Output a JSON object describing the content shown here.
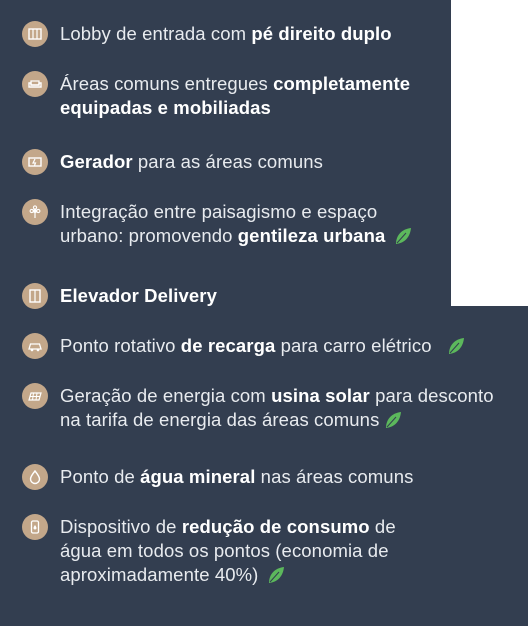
{
  "colors": {
    "panel": "#333e50",
    "icon_circle": "#c3a78a",
    "text": "#e8ebef",
    "leaf": "#5cb85c"
  },
  "items": [
    {
      "icon": "lobby-icon",
      "before": "Lobby de entrada com ",
      "bold": "pé direito duplo",
      "after": "",
      "eco": false
    },
    {
      "icon": "sofa-icon",
      "before": "Áreas comuns entregues ",
      "bold": "completamente equipadas e mobiliadas",
      "after": "",
      "eco": false
    },
    {
      "icon": "generator-icon",
      "before": "",
      "bold": "Gerador",
      "after": " para as áreas comuns",
      "eco": false
    },
    {
      "icon": "flower-icon",
      "before": "Integração entre paisagismo e espaço urbano: promovendo ",
      "bold": "gentileza urbana",
      "after": "",
      "eco": true
    },
    {
      "icon": "elevator-icon",
      "before": "",
      "bold": "Elevador Delivery",
      "after": "",
      "eco": false
    },
    {
      "icon": "car-charger-icon",
      "before": "Ponto rotativo ",
      "bold": "de recarga",
      "after": " para carro elétrico",
      "eco": true
    },
    {
      "icon": "solar-panel-icon",
      "before": "Geração de energia com ",
      "bold": "usina solar",
      "after": " para desconto na tarifa de energia das áreas comuns",
      "eco": true
    },
    {
      "icon": "water-drop-icon",
      "before": "Ponto de ",
      "bold": "água mineral",
      "after": " nas áreas comuns",
      "eco": false
    },
    {
      "icon": "faucet-icon",
      "before": "Dispositivo de ",
      "bold": "redução de consumo",
      "after": " de água em todos os pontos (economia de aproximadamente 40%)",
      "eco": true
    }
  ]
}
